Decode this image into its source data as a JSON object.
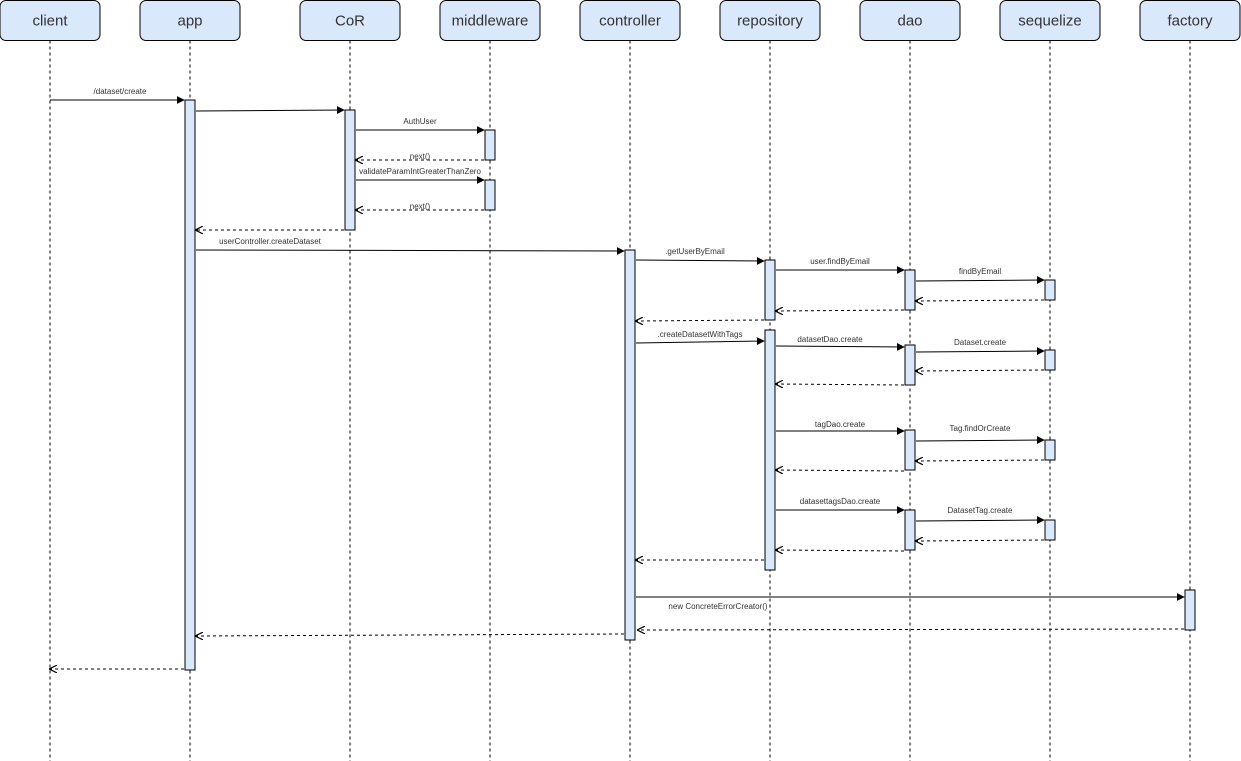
{
  "lifelines": [
    {
      "id": "client",
      "label": "client"
    },
    {
      "id": "app",
      "label": "app"
    },
    {
      "id": "cor",
      "label": "CoR"
    },
    {
      "id": "middleware",
      "label": "middleware"
    },
    {
      "id": "controller",
      "label": "controller"
    },
    {
      "id": "repository",
      "label": "repository"
    },
    {
      "id": "dao",
      "label": "dao"
    },
    {
      "id": "sequelize",
      "label": "sequelize"
    },
    {
      "id": "factory",
      "label": "factory"
    }
  ],
  "messages": [
    {
      "id": "m1",
      "label": "/dataset/create",
      "kind": "call"
    },
    {
      "id": "m2",
      "label": "",
      "kind": "call"
    },
    {
      "id": "m3",
      "label": "AuthUser",
      "kind": "call"
    },
    {
      "id": "m4",
      "label": "next()",
      "kind": "return"
    },
    {
      "id": "m5",
      "label": "validateParamIntGreaterThanZero",
      "kind": "call"
    },
    {
      "id": "m6",
      "label": "next()",
      "kind": "return"
    },
    {
      "id": "m7",
      "label": "",
      "kind": "return"
    },
    {
      "id": "m8",
      "label": "userController.createDataset",
      "kind": "call"
    },
    {
      "id": "m9",
      "label": ".getUserByEmail",
      "kind": "call"
    },
    {
      "id": "m10",
      "label": "user.findByEmail",
      "kind": "call"
    },
    {
      "id": "m11",
      "label": "findByEmail",
      "kind": "call"
    },
    {
      "id": "m12",
      "label": "",
      "kind": "return"
    },
    {
      "id": "m13",
      "label": "",
      "kind": "return"
    },
    {
      "id": "m14",
      "label": "",
      "kind": "return"
    },
    {
      "id": "m15",
      "label": ".createDatasetWithTags",
      "kind": "call"
    },
    {
      "id": "m16",
      "label": "datasetDao.create",
      "kind": "call"
    },
    {
      "id": "m17",
      "label": "Dataset.create",
      "kind": "call"
    },
    {
      "id": "m18",
      "label": "",
      "kind": "return"
    },
    {
      "id": "m19",
      "label": "",
      "kind": "return"
    },
    {
      "id": "m20",
      "label": "tagDao.create",
      "kind": "call"
    },
    {
      "id": "m21",
      "label": "Tag.findOrCreate",
      "kind": "call"
    },
    {
      "id": "m22",
      "label": "",
      "kind": "return"
    },
    {
      "id": "m23",
      "label": "",
      "kind": "return"
    },
    {
      "id": "m24",
      "label": "datasettagsDao.create",
      "kind": "call"
    },
    {
      "id": "m25",
      "label": "DatasetTag.create",
      "kind": "call"
    },
    {
      "id": "m26",
      "label": "",
      "kind": "return"
    },
    {
      "id": "m27",
      "label": "",
      "kind": "return"
    },
    {
      "id": "m28",
      "label": "",
      "kind": "return"
    },
    {
      "id": "m29",
      "label": "new ConcreteErrorCreator()",
      "kind": "call"
    },
    {
      "id": "m30",
      "label": "",
      "kind": "return"
    },
    {
      "id": "m31",
      "label": "",
      "kind": "return"
    },
    {
      "id": "m32",
      "label": "",
      "kind": "return"
    }
  ],
  "colors": {
    "box_fill": "#dae8fc",
    "stroke": "#000000",
    "text": "#333333"
  }
}
